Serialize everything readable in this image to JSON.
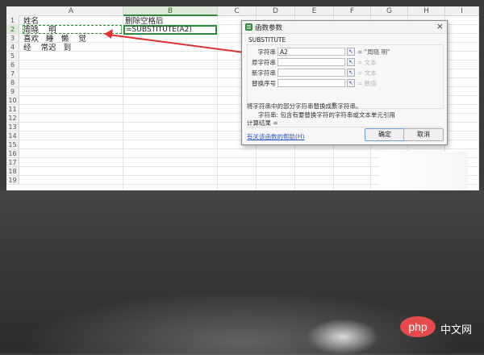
{
  "spreadsheet": {
    "columns": [
      "A",
      "B",
      "C",
      "D",
      "E",
      "F",
      "G",
      "H",
      "I"
    ],
    "rows": [
      "1",
      "2",
      "3",
      "4",
      "5",
      "6",
      "7",
      "8",
      "9",
      "10",
      "11",
      "12",
      "13",
      "14",
      "15",
      "16",
      "17",
      "18",
      "19"
    ],
    "cells": {
      "a1": "姓名",
      "a2": "周晓    明",
      "a3": "喜欢   睡   懒    觉",
      "a4": "经    常迟   到",
      "b1": "删除空格后",
      "b2": "=SUBSTITUTE(A2)"
    },
    "active_column": "B",
    "active_row": "2"
  },
  "dialog": {
    "title": "函数参数",
    "function_name": "SUBSTITUTE",
    "args": [
      {
        "label": "字符串",
        "value": "A2",
        "result": "= \"周晓    明\"",
        "muted": false
      },
      {
        "label": "原字符串",
        "value": "",
        "result": "= 文本",
        "muted": true
      },
      {
        "label": "新字符串",
        "value": "",
        "result": "= 文本",
        "muted": true
      },
      {
        "label": "替换序号",
        "value": "",
        "result": "= 数值",
        "muted": true
      }
    ],
    "total_eq": "=",
    "description": "将字符串中的部分字符串替换成新字符串。",
    "arg_description": "字符串: 包含有要替换字符的字符串或文本单元引用",
    "result_label": "计算结果 =",
    "help_link": "有关该函数的帮助(H)",
    "ok_label": "确定",
    "cancel_label": "取消",
    "close_glyph": "×",
    "pick_glyph": "↖"
  },
  "watermark": {
    "logo": "php",
    "text": "中文网"
  },
  "colors": {
    "accent": "#2e8b3a",
    "arrow": "#e03030"
  }
}
